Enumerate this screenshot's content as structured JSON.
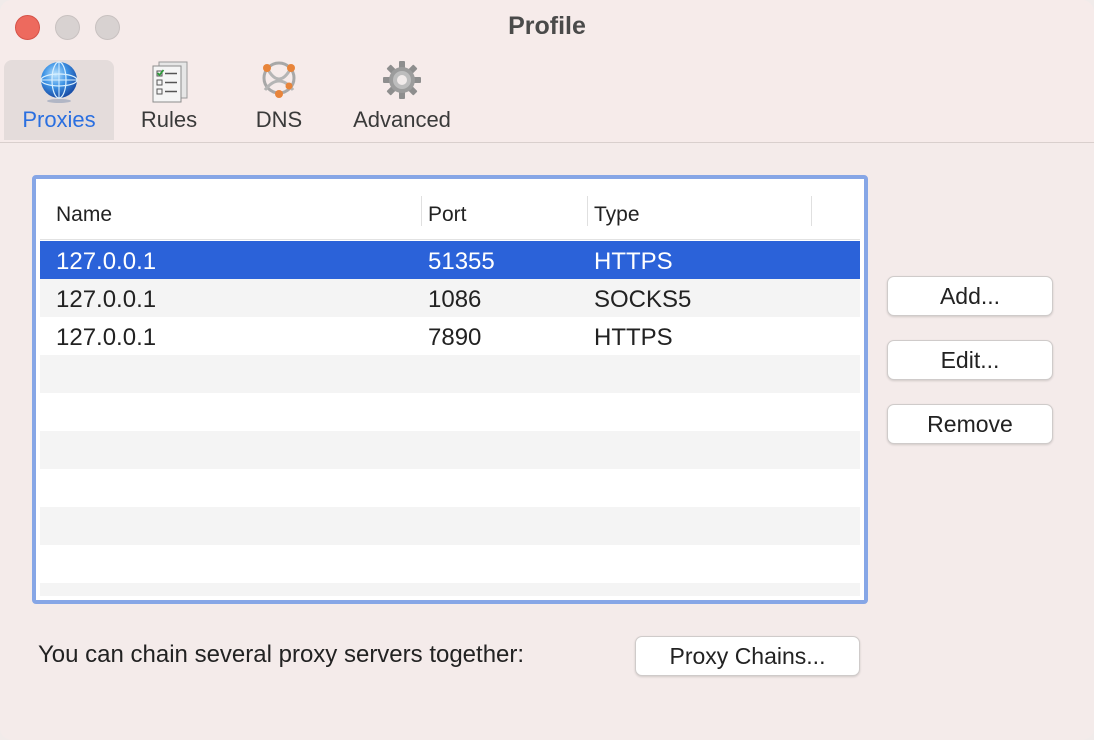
{
  "window": {
    "title": "Profile"
  },
  "toolbar": {
    "tabs": [
      {
        "label": "Proxies",
        "icon": "globe-icon",
        "selected": true
      },
      {
        "label": "Rules",
        "icon": "checklist-icon",
        "selected": false
      },
      {
        "label": "DNS",
        "icon": "network-icon",
        "selected": false
      },
      {
        "label": "Advanced",
        "icon": "gear-icon",
        "selected": false
      }
    ]
  },
  "table": {
    "columns": [
      "Name",
      "Port",
      "Type"
    ],
    "rows": [
      {
        "name": "127.0.0.1",
        "port": "51355",
        "type": "HTTPS",
        "selected": true
      },
      {
        "name": "127.0.0.1",
        "port": "1086",
        "type": "SOCKS5",
        "selected": false
      },
      {
        "name": "127.0.0.1",
        "port": "7890",
        "type": "HTTPS",
        "selected": false
      }
    ]
  },
  "actions": {
    "add": "Add...",
    "edit": "Edit...",
    "remove": "Remove"
  },
  "footer": {
    "text": "You can chain several proxy servers together:",
    "chains_button": "Proxy Chains..."
  },
  "colors": {
    "selection": "#2b62d9",
    "focus_ring": "#86a6e6",
    "tab_selected": "#2a6fe0",
    "close": "#ed6a5e"
  }
}
